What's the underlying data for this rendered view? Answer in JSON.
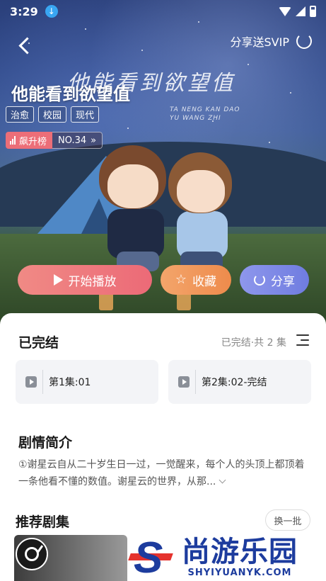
{
  "status_bar": {
    "time": "3:29"
  },
  "header": {
    "share_vip_label": "分享送SVIP"
  },
  "drama": {
    "title": "他能看到欲望值",
    "title_art": "他能看到欲望值",
    "title_art_sub_line1": "TA NENG KAN DAO",
    "title_art_sub_line2": "YU WANG ZHI",
    "tags": [
      "治愈",
      "校园",
      "现代"
    ],
    "rank_label": "飙升榜",
    "rank_no": "NO.34"
  },
  "actions": {
    "play_label": "开始播放",
    "favorite_label": "收藏",
    "share_label": "分享"
  },
  "episodes": {
    "heading": "已完结",
    "summary": "已完结·共 2 集",
    "items": [
      {
        "label": "第1集:01"
      },
      {
        "label": "第2集:02-完结"
      }
    ]
  },
  "synopsis": {
    "heading": "剧情简介",
    "text": "①谢星云自从二十岁生日一过，一觉醒来，每个人的头顶上都顶着一条他看不懂的数值。谢星云的世界，从那..."
  },
  "recommend": {
    "heading": "推荐剧集",
    "refresh_label": "换一批"
  },
  "watermark": {
    "cn": "尚游乐园",
    "en": "SHYIYUANYK.COM"
  },
  "colors": {
    "play_gradient": [
      "#f08a85",
      "#ec6a77"
    ],
    "favorite_gradient": [
      "#f3a56b",
      "#ee8b4c"
    ],
    "share_gradient": [
      "#8e97ec",
      "#6f7ce0"
    ],
    "rank_badge": "#ec6e78"
  }
}
